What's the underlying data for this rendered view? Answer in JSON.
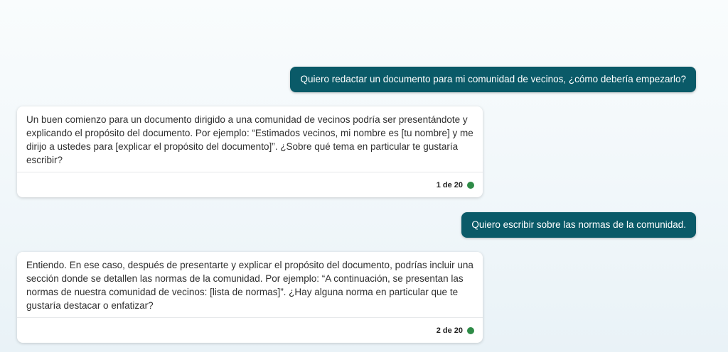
{
  "conversation": {
    "messages": [
      {
        "role": "user",
        "text": "Quiero redactar un documento para mi comunidad de vecinos, ¿cómo debería empezarlo?"
      },
      {
        "role": "assistant",
        "text": "Un buen comienzo para un documento dirigido a una comunidad de vecinos podría ser presentándote y explicando el propósito del documento. Por ejemplo: “Estimados vecinos, mi nombre es [tu nombre] y me dirijo a ustedes para [explicar el propósito del documento]”. ¿Sobre qué tema en particular te gustaría escribir?",
        "counter": "1 de 20",
        "status_color": "#2e8b47"
      },
      {
        "role": "user",
        "text": "Quiero escribir sobre las normas de la comunidad."
      },
      {
        "role": "assistant",
        "text": "Entiendo. En ese caso, después de presentarte y explicar el propósito del documento, podrías incluir una sección donde se detallen las normas de la comunidad. Por ejemplo: “A continuación, se presentan las normas de nuestra comunidad de vecinos: [lista de normas]”. ¿Hay alguna norma en particular que te gustaría destacar o enfatizar?",
        "counter": "2 de 20",
        "status_color": "#2e8b47"
      }
    ]
  },
  "colors": {
    "user_bubble": "#0a5a68",
    "status_dot": "#2e8b47"
  }
}
